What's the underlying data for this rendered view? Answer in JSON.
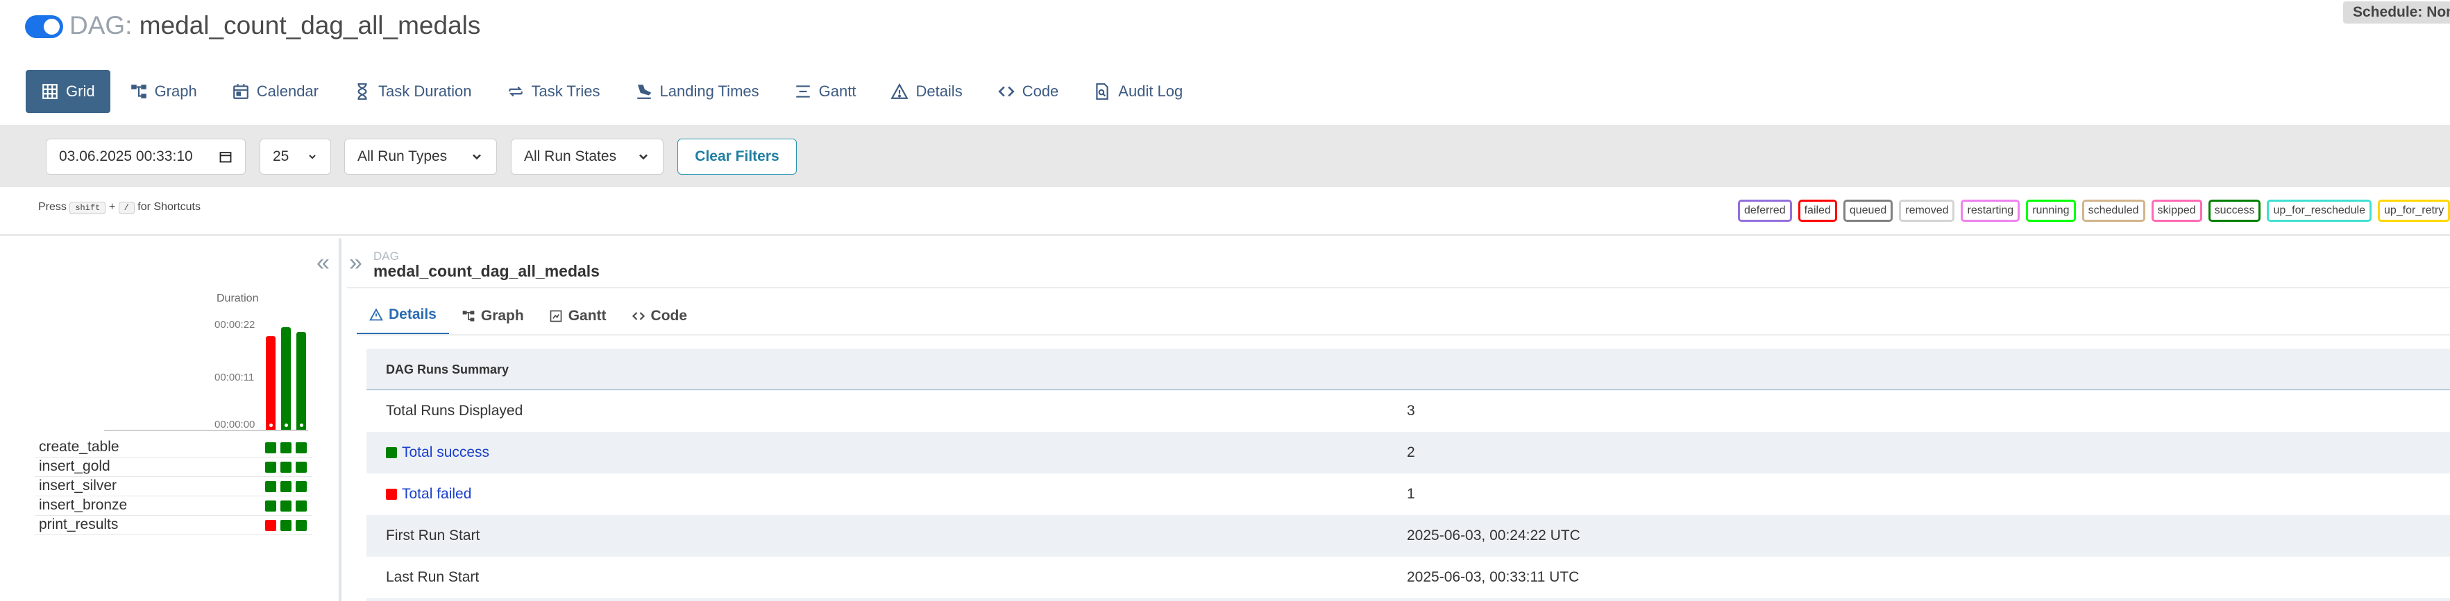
{
  "header": {
    "dag_prefix": "DAG:",
    "dag_name": "medal_count_dag_all_medals",
    "schedule_badge": "Schedule: Non"
  },
  "tabs": [
    {
      "label": "Grid",
      "icon": "grid-icon",
      "active": true
    },
    {
      "label": "Graph",
      "icon": "graph-icon"
    },
    {
      "label": "Calendar",
      "icon": "calendar-icon"
    },
    {
      "label": "Task Duration",
      "icon": "hourglass-icon"
    },
    {
      "label": "Task Tries",
      "icon": "retry-icon"
    },
    {
      "label": "Landing Times",
      "icon": "landing-icon"
    },
    {
      "label": "Gantt",
      "icon": "gantt-icon"
    },
    {
      "label": "Details",
      "icon": "warning-icon"
    },
    {
      "label": "Code",
      "icon": "code-icon"
    },
    {
      "label": "Audit Log",
      "icon": "audit-icon"
    }
  ],
  "filters": {
    "date_value": "03.06.2025 00:33:10",
    "num_runs": "25",
    "run_types": "All Run Types",
    "run_states": "All Run States",
    "clear_label": "Clear Filters"
  },
  "shortcuts": {
    "prefix": "Press",
    "key1": "shift",
    "plus": "+",
    "key2": "/",
    "suffix": "for Shortcuts"
  },
  "legend": [
    {
      "label": "deferred",
      "color": "#9370db"
    },
    {
      "label": "failed",
      "color": "#ff0000"
    },
    {
      "label": "queued",
      "color": "#808080"
    },
    {
      "label": "removed",
      "color": "#d3d3d3"
    },
    {
      "label": "restarting",
      "color": "#ee82ee"
    },
    {
      "label": "running",
      "color": "#00ff00"
    },
    {
      "label": "scheduled",
      "color": "#d2b48c"
    },
    {
      "label": "skipped",
      "color": "#ff69b4"
    },
    {
      "label": "success",
      "color": "#008000"
    },
    {
      "label": "up_for_reschedule",
      "color": "#40e0d0"
    },
    {
      "label": "up_for_retry",
      "color": "#ffd700"
    }
  ],
  "grid": {
    "duration_label": "Duration",
    "ticks": [
      "00:00:22",
      "00:00:11",
      "00:00:00"
    ],
    "run_bars": [
      {
        "state": "failed",
        "duration_fraction": 0.91
      },
      {
        "state": "success",
        "duration_fraction": 1.0
      },
      {
        "state": "success",
        "duration_fraction": 0.95
      }
    ],
    "tasks": [
      {
        "name": "create_table",
        "states": [
          "success",
          "success",
          "success"
        ]
      },
      {
        "name": "insert_gold",
        "states": [
          "success",
          "success",
          "success"
        ]
      },
      {
        "name": "insert_silver",
        "states": [
          "success",
          "success",
          "success"
        ]
      },
      {
        "name": "insert_bronze",
        "states": [
          "success",
          "success",
          "success"
        ]
      },
      {
        "name": "print_results",
        "states": [
          "failed",
          "success",
          "success"
        ]
      }
    ]
  },
  "panel": {
    "crumb_label": "DAG",
    "crumb_name": "medal_count_dag_all_medals",
    "subtabs": [
      {
        "label": "Details",
        "icon": "warning-icon",
        "active": true
      },
      {
        "label": "Graph",
        "icon": "graph-icon"
      },
      {
        "label": "Gantt",
        "icon": "gantt-icon"
      },
      {
        "label": "Code",
        "icon": "code-icon"
      }
    ],
    "summary_title": "DAG Runs Summary",
    "summary_rows": [
      {
        "key": "Total Runs Displayed",
        "value": "3"
      },
      {
        "key": "Total success",
        "value": "2",
        "state": "success",
        "link": true
      },
      {
        "key": "Total failed",
        "value": "1",
        "state": "failed",
        "link": true
      },
      {
        "key": "First Run Start",
        "value": "2025-06-03, 00:24:22 UTC"
      },
      {
        "key": "Last Run Start",
        "value": "2025-06-03, 00:33:11 UTC"
      }
    ]
  },
  "colors": {
    "success": "#008000",
    "failed": "#ff0000",
    "accent": "#3d6489"
  }
}
